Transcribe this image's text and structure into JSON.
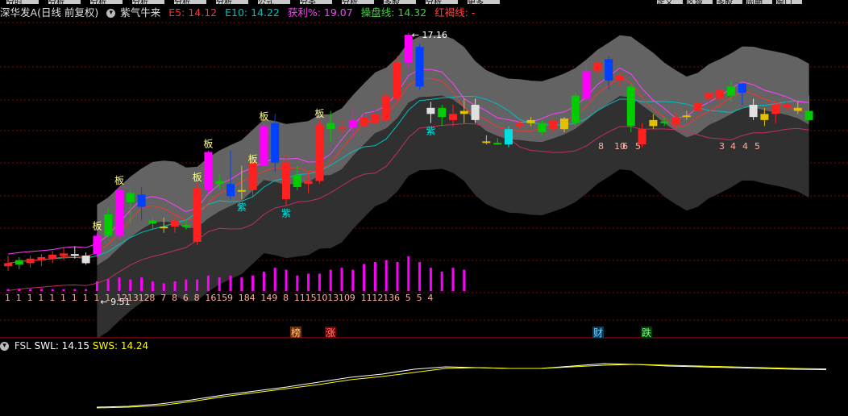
{
  "top_tabs": [
    "分时",
    "分析",
    "分析",
    "分析",
    "分析",
    "分析",
    "公式",
    "分类",
    "分析",
    "多股",
    "分析",
    "更多"
  ],
  "right_tabs": [
    "定义",
    "区域",
    "多股",
    "周期",
    "窗口"
  ],
  "header": {
    "stock_name": "深华发A",
    "period": "(日线 前复权)",
    "indicator": "紫气牛来",
    "e5": "E5: 14.12",
    "e10": "E10: 14.22",
    "profit": "获利%: 19.07",
    "operate": "操盘线: 14.32",
    "red_line": "红褐线: -"
  },
  "sub_header": {
    "name": "FSL",
    "swl": "SWL: 14.15",
    "sws": "SWS: 14.24"
  },
  "colors": {
    "up": "#ff2020",
    "magenta": "#ff00ff",
    "green": "#00cc00",
    "blue": "#0040ff",
    "cyan": "#00e0e0",
    "yellow": "#e0c000",
    "white": "#e0e0e0",
    "grid": "#8a0000",
    "band_upper": "#6e6e6e",
    "band_lower": "#333333",
    "e5": "#ff3030",
    "e10": "#00c0c0",
    "profit": "#ff40ff",
    "operate": "#40d040",
    "swl": "#ffffff",
    "sws": "#ffff00"
  },
  "chart_data": [
    {
      "type": "candlestick",
      "ylim": [
        8.5,
        17.5
      ],
      "candles": [
        {
          "o": 9.5,
          "h": 9.85,
          "l": 9.35,
          "c": 9.6,
          "color": "red"
        },
        {
          "o": 9.55,
          "h": 9.8,
          "l": 9.4,
          "c": 9.7,
          "color": "green"
        },
        {
          "o": 9.6,
          "h": 9.85,
          "l": 9.45,
          "c": 9.75,
          "color": "red"
        },
        {
          "o": 9.7,
          "h": 9.9,
          "l": 9.5,
          "c": 9.8,
          "color": "red"
        },
        {
          "o": 9.75,
          "h": 10.0,
          "l": 9.6,
          "c": 9.88,
          "color": "red"
        },
        {
          "o": 9.85,
          "h": 10.1,
          "l": 9.7,
          "c": 9.92,
          "color": "red"
        },
        {
          "o": 9.9,
          "h": 10.15,
          "l": 9.75,
          "c": 9.85,
          "color": "white"
        },
        {
          "o": 9.85,
          "h": 9.95,
          "l": 9.55,
          "c": 9.6,
          "color": "white"
        },
        {
          "o": 9.9,
          "h": 10.6,
          "l": 9.8,
          "c": 10.5,
          "color": "magenta",
          "label": "板"
        },
        {
          "o": 10.5,
          "h": 11.4,
          "l": 10.45,
          "c": 11.2,
          "color": "green"
        },
        {
          "o": 10.5,
          "h": 12.1,
          "l": 10.4,
          "c": 12.0,
          "color": "magenta",
          "label": "板"
        },
        {
          "o": 11.6,
          "h": 12.0,
          "l": 10.9,
          "c": 11.9,
          "color": "green"
        },
        {
          "o": 11.85,
          "h": 12.1,
          "l": 11.0,
          "c": 11.45,
          "color": "blue"
        },
        {
          "o": 11.0,
          "h": 11.1,
          "l": 10.7,
          "c": 10.9,
          "color": "green"
        },
        {
          "o": 10.8,
          "h": 11.1,
          "l": 10.6,
          "c": 10.75,
          "color": "yellow"
        },
        {
          "o": 10.8,
          "h": 11.15,
          "l": 10.6,
          "c": 11.0,
          "color": "red"
        },
        {
          "o": 10.8,
          "h": 11.0,
          "l": 10.7,
          "c": 10.85,
          "color": "green"
        },
        {
          "o": 10.3,
          "h": 12.2,
          "l": 10.2,
          "c": 12.05,
          "color": "red",
          "label": "板"
        },
        {
          "o": 12.0,
          "h": 13.3,
          "l": 11.9,
          "c": 13.25,
          "color": "magenta",
          "label": "板"
        },
        {
          "o": 12.2,
          "h": 12.5,
          "l": 12.0,
          "c": 12.3,
          "color": "green"
        },
        {
          "o": 12.2,
          "h": 13.3,
          "l": 11.7,
          "c": 11.8,
          "color": "blue"
        },
        {
          "o": 12.0,
          "h": 12.8,
          "l": 11.7,
          "c": 12.0,
          "color": "yellow",
          "label": "紫"
        },
        {
          "o": 12.0,
          "h": 12.8,
          "l": 11.8,
          "c": 12.9,
          "color": "red",
          "label": "板"
        },
        {
          "o": 12.8,
          "h": 14.2,
          "l": 12.7,
          "c": 14.1,
          "color": "magenta",
          "label": "板"
        },
        {
          "o": 14.2,
          "h": 14.5,
          "l": 12.6,
          "c": 12.9,
          "color": "blue"
        },
        {
          "o": 12.9,
          "h": 13.2,
          "l": 11.5,
          "c": 11.7,
          "color": "red",
          "label": "紫"
        },
        {
          "o": 12.5,
          "h": 12.8,
          "l": 12.0,
          "c": 12.1,
          "color": "green"
        },
        {
          "o": 12.2,
          "h": 12.6,
          "l": 11.9,
          "c": 12.3,
          "color": "red"
        },
        {
          "o": 12.3,
          "h": 14.3,
          "l": 12.2,
          "c": 14.15,
          "color": "red",
          "label": "板"
        },
        {
          "o": 14.0,
          "h": 14.6,
          "l": 13.6,
          "c": 14.2,
          "color": "green"
        },
        {
          "o": 14.0,
          "h": 14.3,
          "l": 13.8,
          "c": 14.05,
          "color": "red"
        },
        {
          "o": 14.05,
          "h": 14.7,
          "l": 13.7,
          "c": 14.3,
          "color": "magenta"
        },
        {
          "o": 14.1,
          "h": 14.6,
          "l": 13.8,
          "c": 14.4,
          "color": "red"
        },
        {
          "o": 14.2,
          "h": 14.8,
          "l": 14.0,
          "c": 14.5,
          "color": "red"
        },
        {
          "o": 14.3,
          "h": 15.3,
          "l": 14.2,
          "c": 15.1,
          "color": "red"
        },
        {
          "o": 15.0,
          "h": 16.4,
          "l": 14.8,
          "c": 16.2,
          "color": "red"
        },
        {
          "o": 16.2,
          "h": 17.16,
          "l": 16.0,
          "c": 17.1,
          "color": "magenta"
        },
        {
          "o": 16.7,
          "h": 16.8,
          "l": 15.3,
          "c": 15.4,
          "color": "blue"
        },
        {
          "o": 14.7,
          "h": 14.9,
          "l": 14.2,
          "c": 14.5,
          "color": "white",
          "label": "紫"
        },
        {
          "o": 14.4,
          "h": 14.8,
          "l": 14.1,
          "c": 14.7,
          "color": "green"
        },
        {
          "o": 14.5,
          "h": 14.8,
          "l": 14.1,
          "c": 14.3,
          "color": "red"
        },
        {
          "o": 14.5,
          "h": 15.0,
          "l": 14.2,
          "c": 14.6,
          "color": "yellow"
        },
        {
          "o": 14.8,
          "h": 15.0,
          "l": 14.2,
          "c": 14.3,
          "color": "white"
        },
        {
          "o": 13.6,
          "h": 13.8,
          "l": 13.5,
          "c": 13.6,
          "color": "yellow"
        },
        {
          "o": 13.55,
          "h": 13.7,
          "l": 13.5,
          "c": 13.55,
          "color": "green"
        },
        {
          "o": 13.5,
          "h": 14.1,
          "l": 13.4,
          "c": 14.0,
          "color": "cyan"
        },
        {
          "o": 14.1,
          "h": 14.3,
          "l": 14.0,
          "c": 14.2,
          "color": "red"
        },
        {
          "o": 14.2,
          "h": 14.4,
          "l": 14.1,
          "c": 14.3,
          "color": "yellow"
        },
        {
          "o": 13.9,
          "h": 14.3,
          "l": 13.8,
          "c": 14.2,
          "color": "green"
        },
        {
          "o": 14.0,
          "h": 14.35,
          "l": 13.9,
          "c": 14.3,
          "color": "red"
        },
        {
          "o": 14.0,
          "h": 14.4,
          "l": 13.9,
          "c": 14.35,
          "color": "yellow"
        },
        {
          "o": 14.2,
          "h": 15.2,
          "l": 14.1,
          "c": 15.1,
          "color": "green"
        },
        {
          "o": 15.0,
          "h": 16.2,
          "l": 14.9,
          "c": 15.9,
          "color": "magenta"
        },
        {
          "o": 15.9,
          "h": 16.5,
          "l": 15.7,
          "c": 16.2,
          "color": "red"
        },
        {
          "o": 16.3,
          "h": 16.4,
          "l": 15.3,
          "c": 15.6,
          "color": "blue"
        },
        {
          "o": 15.6,
          "h": 15.9,
          "l": 15.4,
          "c": 15.75,
          "color": "red"
        },
        {
          "o": 15.4,
          "h": 15.5,
          "l": 13.9,
          "c": 14.1,
          "color": "green"
        },
        {
          "o": 14.0,
          "h": 14.2,
          "l": 13.4,
          "c": 13.5,
          "color": "red"
        },
        {
          "o": 14.1,
          "h": 14.5,
          "l": 14.0,
          "c": 14.3,
          "color": "yellow"
        },
        {
          "o": 14.2,
          "h": 14.4,
          "l": 14.1,
          "c": 14.25,
          "color": "green"
        },
        {
          "o": 14.4,
          "h": 14.6,
          "l": 14.0,
          "c": 14.15,
          "color": "red"
        },
        {
          "o": 14.4,
          "h": 14.6,
          "l": 14.3,
          "c": 14.45,
          "color": "yellow"
        },
        {
          "o": 14.6,
          "h": 14.9,
          "l": 14.5,
          "c": 14.85,
          "color": "red"
        },
        {
          "o": 15.0,
          "h": 15.3,
          "l": 14.8,
          "c": 15.2,
          "color": "red"
        },
        {
          "o": 15.0,
          "h": 15.4,
          "l": 14.7,
          "c": 15.3,
          "color": "red"
        },
        {
          "o": 15.1,
          "h": 15.6,
          "l": 14.9,
          "c": 15.4,
          "color": "green"
        },
        {
          "o": 15.2,
          "h": 15.5,
          "l": 14.8,
          "c": 15.5,
          "color": "blue"
        },
        {
          "o": 14.8,
          "h": 15.0,
          "l": 14.3,
          "c": 14.4,
          "color": "white"
        },
        {
          "o": 14.5,
          "h": 14.7,
          "l": 14.1,
          "c": 14.3,
          "color": "yellow"
        },
        {
          "o": 14.5,
          "h": 14.9,
          "l": 14.2,
          "c": 14.8,
          "color": "red"
        },
        {
          "o": 14.7,
          "h": 14.95,
          "l": 14.6,
          "c": 14.8,
          "color": "red"
        },
        {
          "o": 14.6,
          "h": 14.9,
          "l": 14.5,
          "c": 14.7,
          "color": "yellow"
        },
        {
          "o": 14.6,
          "h": 15.1,
          "l": 14.3,
          "c": 14.3,
          "color": "green"
        }
      ],
      "volume": [
        1,
        1,
        1,
        1,
        1,
        1,
        1,
        1,
        5,
        6,
        7,
        6,
        7,
        5,
        4,
        5,
        6,
        6,
        8,
        7,
        8,
        7,
        8,
        10,
        12,
        11,
        8,
        9,
        9,
        11,
        12,
        11,
        14,
        15,
        16,
        15,
        18,
        15,
        12,
        10,
        12,
        11
      ],
      "counts": [
        "1",
        "1",
        "1",
        "1",
        "1",
        "1",
        "1",
        "1",
        "1",
        "1",
        "12",
        "13",
        "12",
        "8",
        "7",
        "8",
        "6",
        "8",
        "16",
        "15",
        "9",
        "18",
        "4",
        "14",
        "9",
        "8",
        "11",
        "15",
        "10",
        "13",
        "10",
        "9",
        "11",
        "12",
        "13",
        "6",
        "5",
        "5",
        "4"
      ],
      "right_counts": [
        "8",
        "10",
        "6",
        "5",
        "3",
        "4",
        "4",
        "5"
      ],
      "marks": {
        "high": "17.16",
        "low": "9.51",
        "volume_labels": [
          "榜",
          "涨",
          "财",
          "跌"
        ]
      }
    },
    {
      "type": "line",
      "series": [
        {
          "name": "SWL",
          "values": [
            9.5,
            9.6,
            9.9,
            10.4,
            11.0,
            11.5,
            12.0,
            12.6,
            13.2,
            13.6,
            14.2,
            14.5,
            14.4,
            14.3,
            14.3,
            14.6,
            14.9,
            14.8,
            14.6,
            14.5,
            14.4,
            14.3,
            14.2,
            14.15
          ]
        },
        {
          "name": "SWS",
          "values": [
            9.4,
            9.5,
            9.7,
            10.2,
            10.8,
            11.3,
            11.8,
            12.3,
            12.9,
            13.3,
            13.8,
            14.3,
            14.4,
            14.3,
            14.3,
            14.5,
            14.7,
            14.8,
            14.7,
            14.6,
            14.5,
            14.4,
            14.3,
            14.24
          ]
        }
      ]
    }
  ]
}
